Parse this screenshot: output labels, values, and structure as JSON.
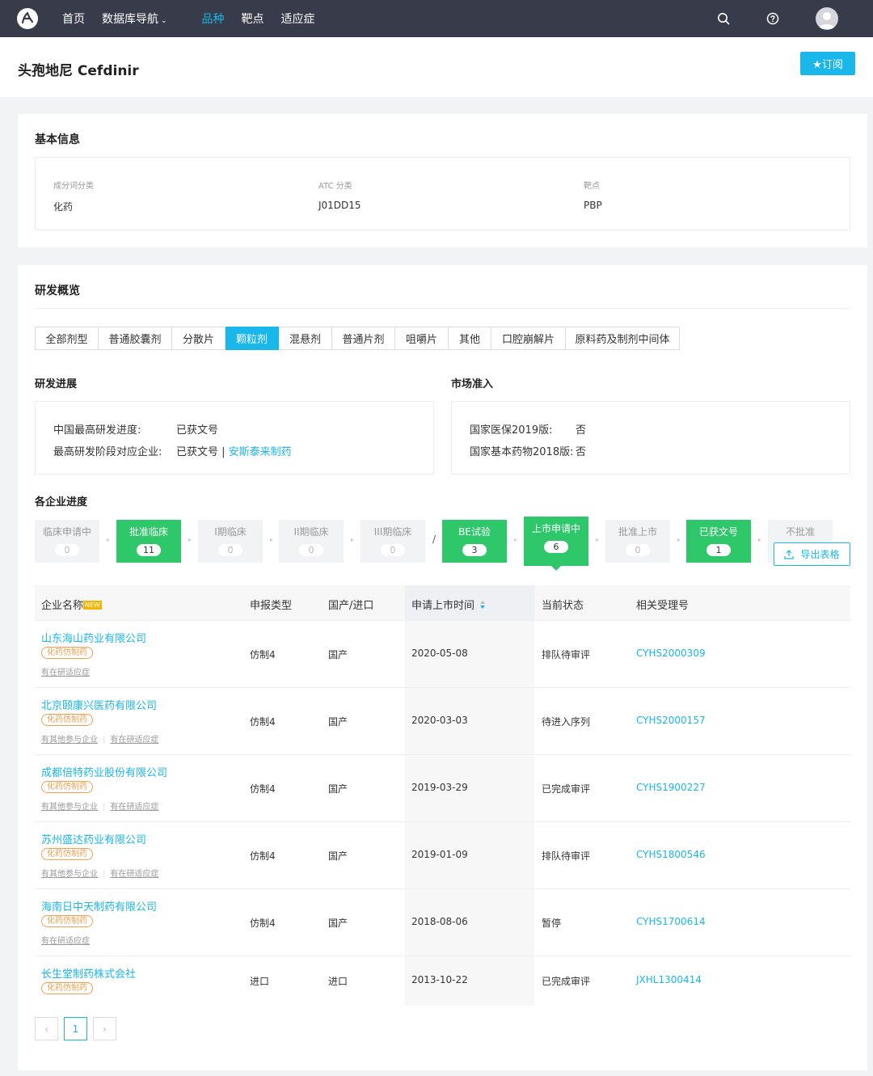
{
  "nav": {
    "items": [
      {
        "label": "首页",
        "active": false,
        "dropdown": false
      },
      {
        "label": "数据库导航",
        "active": false,
        "dropdown": true
      },
      {
        "label": "品种",
        "active": true,
        "dropdown": false
      },
      {
        "label": "靶点",
        "active": false,
        "dropdown": false
      },
      {
        "label": "适应症",
        "active": false,
        "dropdown": false
      }
    ],
    "icons": [
      "logo-icon",
      "search-icon",
      "help-icon",
      "avatar"
    ],
    "caret": "⌄"
  },
  "header": {
    "title": "头孢地尼 Cefdinir",
    "subscribe_label": "★订阅"
  },
  "basic": {
    "title": "基本信息",
    "fields": [
      {
        "label": "成分词分类",
        "value": "化药"
      },
      {
        "label": "ATC 分类",
        "value": "J01DD15"
      },
      {
        "label": "靶点",
        "value": "PBP"
      }
    ]
  },
  "rd": {
    "title": "研发概览",
    "tabs": [
      "全部剂型",
      "普通胶囊剂",
      "分散片",
      "颗粒剂",
      "混悬剂",
      "普通片剂",
      "咀嚼片",
      "其他",
      "口腔崩解片",
      "原料药及制剂中间体"
    ],
    "active_tab": "颗粒剂",
    "progress": {
      "title": "研发进展",
      "rows": [
        {
          "label": "中国最高研发进度:",
          "value": "已获文号"
        },
        {
          "label": "最高研发阶段对应企业:",
          "value": "已获文号 | ",
          "link": "安斯泰来制药"
        }
      ]
    },
    "market": {
      "title": "市场准入",
      "rows": [
        {
          "label": "国家医保2019版:",
          "value": "否"
        },
        {
          "label": "国家基本药物2018版:",
          "value": "否"
        }
      ]
    },
    "stages_title": "各企业进度",
    "stages": [
      {
        "name": "临床申请中",
        "count": "0",
        "green": false
      },
      {
        "name": "批准临床",
        "count": "11",
        "green": true
      },
      {
        "name": "I期临床",
        "count": "0",
        "green": false
      },
      {
        "name": "II期临床",
        "count": "0",
        "green": false
      },
      {
        "name": "III期临床",
        "count": "0",
        "green": false
      },
      {
        "name": "BE试验",
        "count": "3",
        "green": true
      },
      {
        "name": "上市申请中",
        "count": "6",
        "green": true,
        "current": true
      },
      {
        "name": "批准上市",
        "count": "0",
        "green": false
      },
      {
        "name": "已获文号",
        "count": "1",
        "green": true
      },
      {
        "name": "不批准",
        "count": "",
        "green": false
      }
    ],
    "stage_separator": "/",
    "stage_arrow": "▸",
    "export_label": "导出表格"
  },
  "table": {
    "headers": {
      "company": "企业名称",
      "new_badge": "NEW",
      "type": "申报类型",
      "origin": "国产/进口",
      "date": "申请上市时间",
      "status": "当前状态",
      "acceptance": "相关受理号"
    },
    "rows": [
      {
        "company": "山东海山药业有限公司",
        "tag": "化药仿制药",
        "links": [
          "有在研适应症"
        ],
        "type": "仿制4",
        "origin": "国产",
        "date": "2020-05-08",
        "status": "排队待审评",
        "acceptance": "CYHS2000309"
      },
      {
        "company": "北京颐康兴医药有限公司",
        "tag": "化药仿制药",
        "links": [
          "有其他参与企业",
          "有在研适应症"
        ],
        "type": "仿制4",
        "origin": "国产",
        "date": "2020-03-03",
        "status": "待进入序列",
        "acceptance": "CYHS2000157"
      },
      {
        "company": "成都倍特药业股份有限公司",
        "tag": "化药仿制药",
        "links": [
          "有其他参与企业",
          "有在研适应症"
        ],
        "type": "仿制4",
        "origin": "国产",
        "date": "2019-03-29",
        "status": "已完成审评",
        "acceptance": "CYHS1900227"
      },
      {
        "company": "苏州盛达药业有限公司",
        "tag": "化药仿制药",
        "links": [
          "有其他参与企业",
          "有在研适应症"
        ],
        "type": "仿制4",
        "origin": "国产",
        "date": "2019-01-09",
        "status": "排队待审评",
        "acceptance": "CYHS1800546"
      },
      {
        "company": "海南日中天制药有限公司",
        "tag": "化药仿制药",
        "links": [
          "有在研适应症"
        ],
        "type": "仿制4",
        "origin": "国产",
        "date": "2018-08-06",
        "status": "暂停",
        "acceptance": "CYHS1700614"
      },
      {
        "company": "长生堂制药株式会社",
        "tag": "化药仿制药",
        "links": [],
        "type": "进口",
        "origin": "进口",
        "date": "2013-10-22",
        "status": "已完成审评",
        "acceptance": "JXHL1300414"
      }
    ]
  },
  "pager": {
    "prev": "‹",
    "current": "1",
    "next": "›"
  },
  "colors": {
    "accent": "#1ab7ea",
    "green": "#2ec86b",
    "nav_bg": "#383c4a",
    "tag_orange": "#f0a050"
  }
}
